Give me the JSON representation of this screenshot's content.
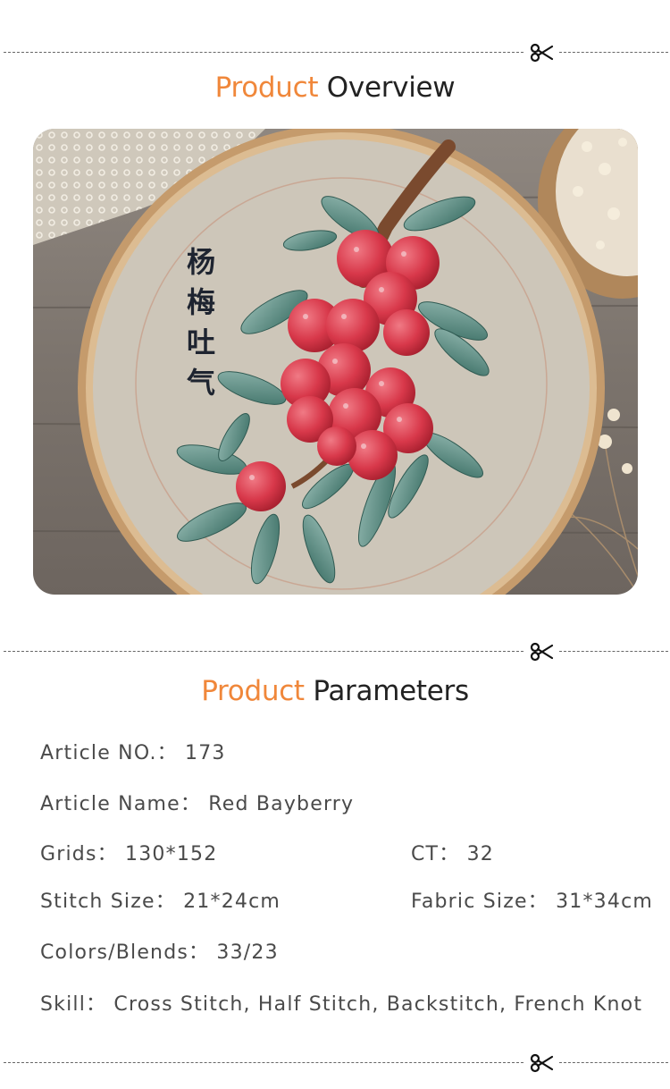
{
  "overview": {
    "heading_accent": "Product",
    "heading_rest": "Overview",
    "chinese_text": [
      "杨",
      "梅",
      "吐",
      "气"
    ]
  },
  "parameters": {
    "heading_accent": "Product",
    "heading_rest": "Parameters",
    "article_no": "Article NO.：  173",
    "article_name": "Article Name：  Red Bayberry",
    "grids": "Grids：  130*152",
    "ct": "CT：  32",
    "stitch_size": "Stitch Size：  21*24cm",
    "fabric_size": "Fabric Size：  31*34cm",
    "colors_blends": "Colors/Blends：  33/23",
    "skill": "Skill：  Cross Stitch, Half Stitch, Backstitch, French Knot"
  },
  "colors": {
    "accent": "#f0873a",
    "heading": "#222222",
    "text": "#4a4a4a"
  },
  "icons": {
    "divider": "scissors-icon"
  }
}
